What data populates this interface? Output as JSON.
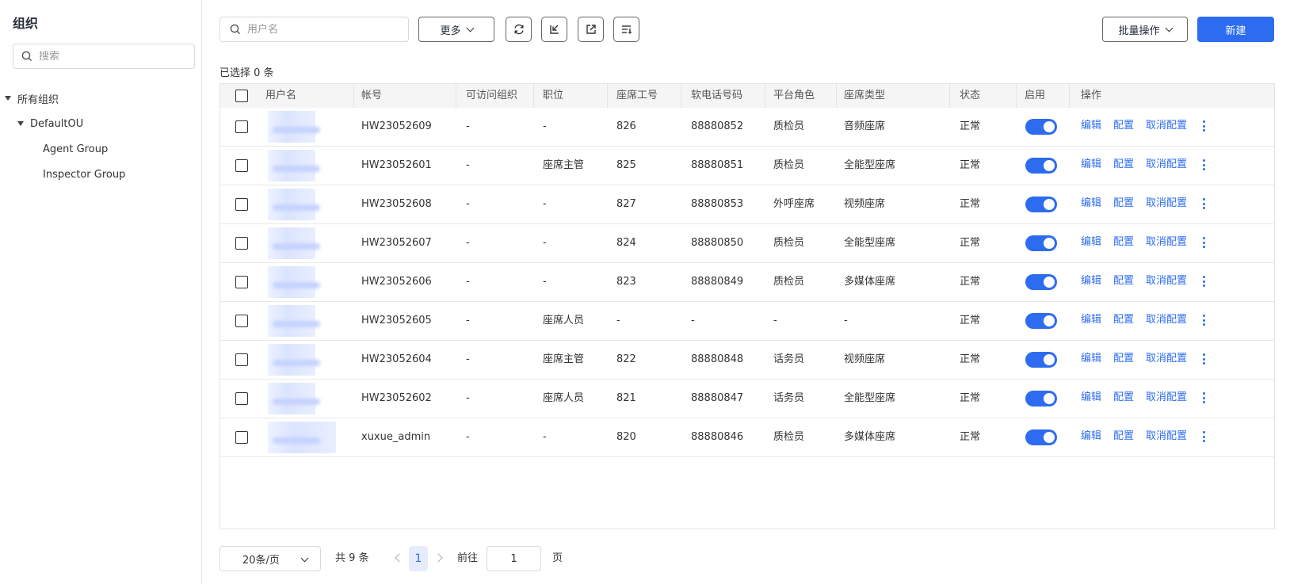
{
  "sidebar": {
    "title": "组织",
    "search_placeholder": "搜索",
    "tree": [
      {
        "label": "所有组织",
        "level": 0,
        "expanded": true
      },
      {
        "label": "DefaultOU",
        "level": 1,
        "expanded": true
      },
      {
        "label": "Agent Group",
        "level": 2
      },
      {
        "label": "Inspector Group",
        "level": 2
      }
    ]
  },
  "toolbar": {
    "search_placeholder": "用户名",
    "more_label": "更多",
    "icons": [
      "refresh-icon",
      "import-icon",
      "export-icon",
      "column-settings-icon"
    ],
    "batch_label": "批量操作",
    "new_label": "新建"
  },
  "selected_text": "已选择 0 条",
  "table": {
    "headers": [
      "用户名",
      "帐号",
      "可访问组织",
      "职位",
      "座席工号",
      "软电话号码",
      "平台角色",
      "座席类型",
      "状态",
      "启用",
      "操作"
    ],
    "actions": [
      "编辑",
      "配置",
      "取消配置"
    ],
    "rows": [
      {
        "account": "HW23052609",
        "org": "-",
        "position": "-",
        "agent_id": "826",
        "phone": "88880852",
        "role": "质检员",
        "type": "音频座席",
        "status": "正常",
        "enabled": true
      },
      {
        "account": "HW23052601",
        "org": "-",
        "position": "座席主管",
        "agent_id": "825",
        "phone": "88880851",
        "role": "质检员",
        "type": "全能型座席",
        "status": "正常",
        "enabled": true
      },
      {
        "account": "HW23052608",
        "org": "-",
        "position": "-",
        "agent_id": "827",
        "phone": "88880853",
        "role": "外呼座席",
        "type": "视频座席",
        "status": "正常",
        "enabled": true
      },
      {
        "account": "HW23052607",
        "org": "-",
        "position": "-",
        "agent_id": "824",
        "phone": "88880850",
        "role": "质检员",
        "type": "全能型座席",
        "status": "正常",
        "enabled": true
      },
      {
        "account": "HW23052606",
        "org": "-",
        "position": "-",
        "agent_id": "823",
        "phone": "88880849",
        "role": "质检员",
        "type": "多媒体座席",
        "status": "正常",
        "enabled": true
      },
      {
        "account": "HW23052605",
        "org": "-",
        "position": "座席人员",
        "agent_id": "-",
        "phone": "-",
        "role": "-",
        "type": "-",
        "status": "正常",
        "enabled": true
      },
      {
        "account": "HW23052604",
        "org": "-",
        "position": "座席主管",
        "agent_id": "822",
        "phone": "88880848",
        "role": "话务员",
        "type": "视频座席",
        "status": "正常",
        "enabled": true
      },
      {
        "account": "HW23052602",
        "org": "-",
        "position": "座席人员",
        "agent_id": "821",
        "phone": "88880847",
        "role": "话务员",
        "type": "全能型座席",
        "status": "正常",
        "enabled": true
      },
      {
        "account": "xuxue_admin",
        "org": "-",
        "position": "-",
        "agent_id": "820",
        "phone": "88880846",
        "role": "质检员",
        "type": "多媒体座席",
        "status": "正常",
        "enabled": true
      }
    ]
  },
  "pagination": {
    "page_size": "20条/页",
    "total": "共 9 条",
    "current_page": "1",
    "goto_label": "前往",
    "goto_value": "1",
    "goto_unit": "页"
  },
  "colors": {
    "primary": "#2d6cf0",
    "header_bg": "#f5f5f6",
    "border": "#e4e4e4"
  }
}
